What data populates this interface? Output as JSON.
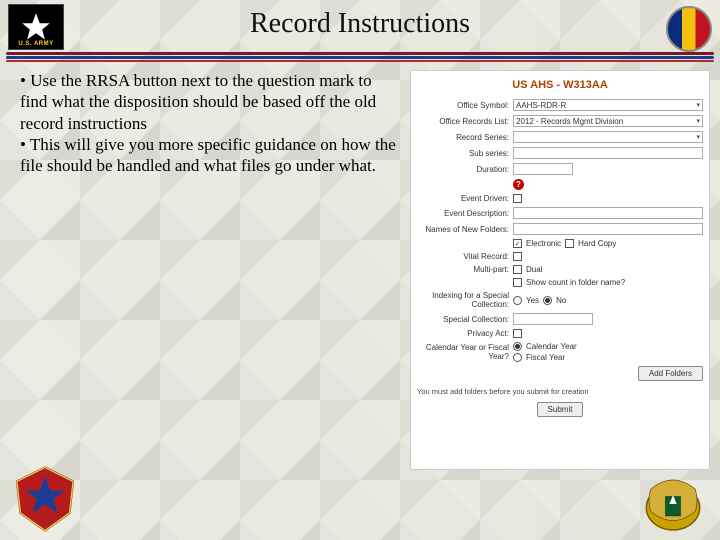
{
  "header": {
    "title": "Record Instructions",
    "army_label": "U.S. ARMY"
  },
  "bullets": {
    "b1": "• Use the RRSA button next to the question mark to find what the disposition should be based off the old record instructions",
    "b2": "• This will give you more specific guidance on how the file should be handled and what files go under what."
  },
  "form": {
    "heading": "US AHS - W313AA",
    "labels": {
      "office_symbol": "Office Symbol:",
      "office_records_list": "Office Records List:",
      "record_series": "Record Series:",
      "sub_series": "Sub series:",
      "duration": "Duration:",
      "event_driven": "Event Driven:",
      "event_description": "Event Description:",
      "names_new_folders": "Names of New Folders:",
      "vital_record": "Vital Record:",
      "multi_part": "Multi-part:",
      "indexing": "Indexing for a Special Collection:",
      "special_collection": "Special Collection:",
      "privacy_act": "Privacy Act:",
      "calendar_fiscal": "Calendar Year or Fiscal Year?"
    },
    "values": {
      "office_symbol": "AAHS-RDR-R",
      "office_records_list": "2012 - Records Mgmt Division",
      "record_series": "",
      "sub_series": "",
      "duration": ""
    },
    "options": {
      "electronic": "Electronic",
      "hard_copy": "Hard Copy",
      "dual": "Dual",
      "show_count": "Show count in folder name?",
      "yes": "Yes",
      "no": "No",
      "calendar_year": "Calendar Year",
      "fiscal_year": "Fiscal Year"
    },
    "buttons": {
      "add_folders": "Add Folders",
      "submit": "Submit"
    },
    "note": "You must add folders before you submit for creation"
  }
}
